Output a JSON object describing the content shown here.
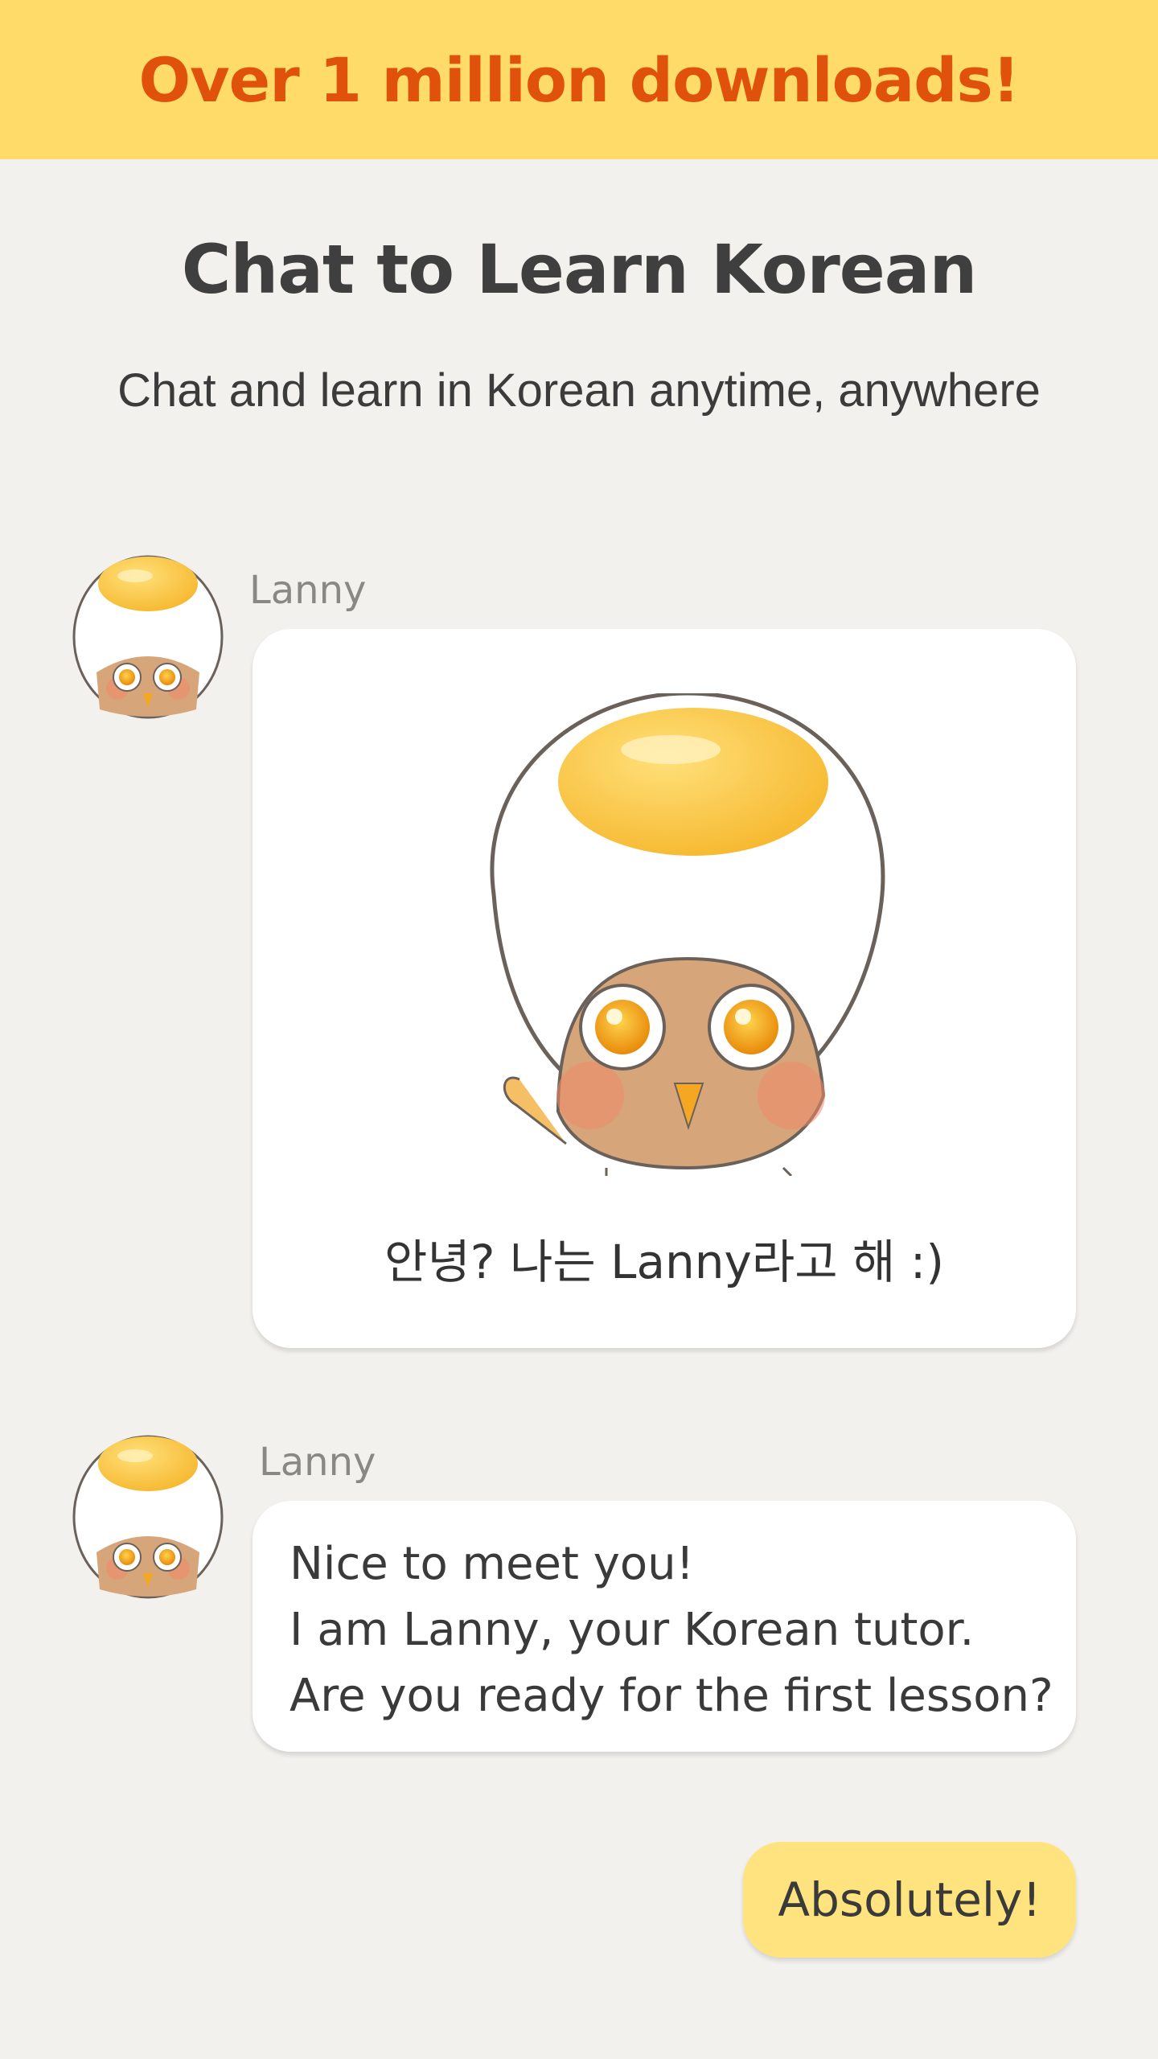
{
  "banner": {
    "text": "Over 1 million downloads!"
  },
  "hero": {
    "title": "Chat to Learn Korean",
    "subtitle": "Chat and learn in Korean anytime, anywhere"
  },
  "messages": [
    {
      "sender": "Lanny",
      "avatar_icon": "egg-owl-avatar-icon",
      "sticker_icon": "waving-egg-owl-sticker-icon",
      "caption": "안녕? 나는 Lanny라고 해 :)"
    },
    {
      "sender": "Lanny",
      "avatar_icon": "egg-owl-avatar-icon",
      "lines": [
        "Nice to meet you!",
        "I am Lanny, your Korean tutor.",
        "Are you ready for the first lesson?"
      ]
    }
  ],
  "reply": {
    "text": "Absolutely!"
  },
  "colors": {
    "banner_bg": "#ffdc6a",
    "banner_text": "#e0520c",
    "page_bg": "#f3f1ed",
    "reply_bubble": "#ffe37f"
  }
}
